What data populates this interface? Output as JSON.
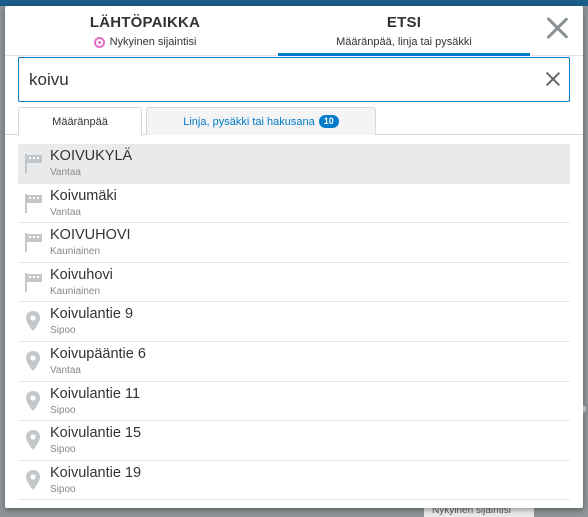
{
  "header": {
    "origin_title": "LÄHTÖPAIKKA",
    "origin_subtitle": "Nykyinen sijaintisi",
    "search_title": "ETSI",
    "search_subtitle": "Määränpää, linja tai pysäkki"
  },
  "search": {
    "value": "koivu",
    "placeholder": ""
  },
  "result_tabs": {
    "destination_label": "Määränpää",
    "stops_label": "Linja, pysäkki tai hakusana",
    "stops_count": "10"
  },
  "results": [
    {
      "title": "KOIVUKYLÄ",
      "subtitle": "Vantaa",
      "icon": "area-icon"
    },
    {
      "title": "Koivumäki",
      "subtitle": "Vantaa",
      "icon": "area-icon"
    },
    {
      "title": "KOIVUHOVI",
      "subtitle": "Kauniainen",
      "icon": "area-icon"
    },
    {
      "title": "Koivuhovi",
      "subtitle": "Kauniainen",
      "icon": "area-icon"
    },
    {
      "title": "Koivulantie 9",
      "subtitle": "Sipoo",
      "icon": "location-pin-icon"
    },
    {
      "title": "Koivupääntie 6",
      "subtitle": "Vantaa",
      "icon": "location-pin-icon"
    },
    {
      "title": "Koivulantie 11",
      "subtitle": "Sipoo",
      "icon": "location-pin-icon"
    },
    {
      "title": "Koivulantie 15",
      "subtitle": "Sipoo",
      "icon": "location-pin-icon"
    },
    {
      "title": "Koivulantie 19",
      "subtitle": "Sipoo",
      "icon": "location-pin-icon"
    }
  ],
  "map_chip": "Nykyinen sijaintisi",
  "colors": {
    "accent": "#007ac9",
    "origin": "#e26fc6",
    "selected_row": "#e8eaeb"
  }
}
